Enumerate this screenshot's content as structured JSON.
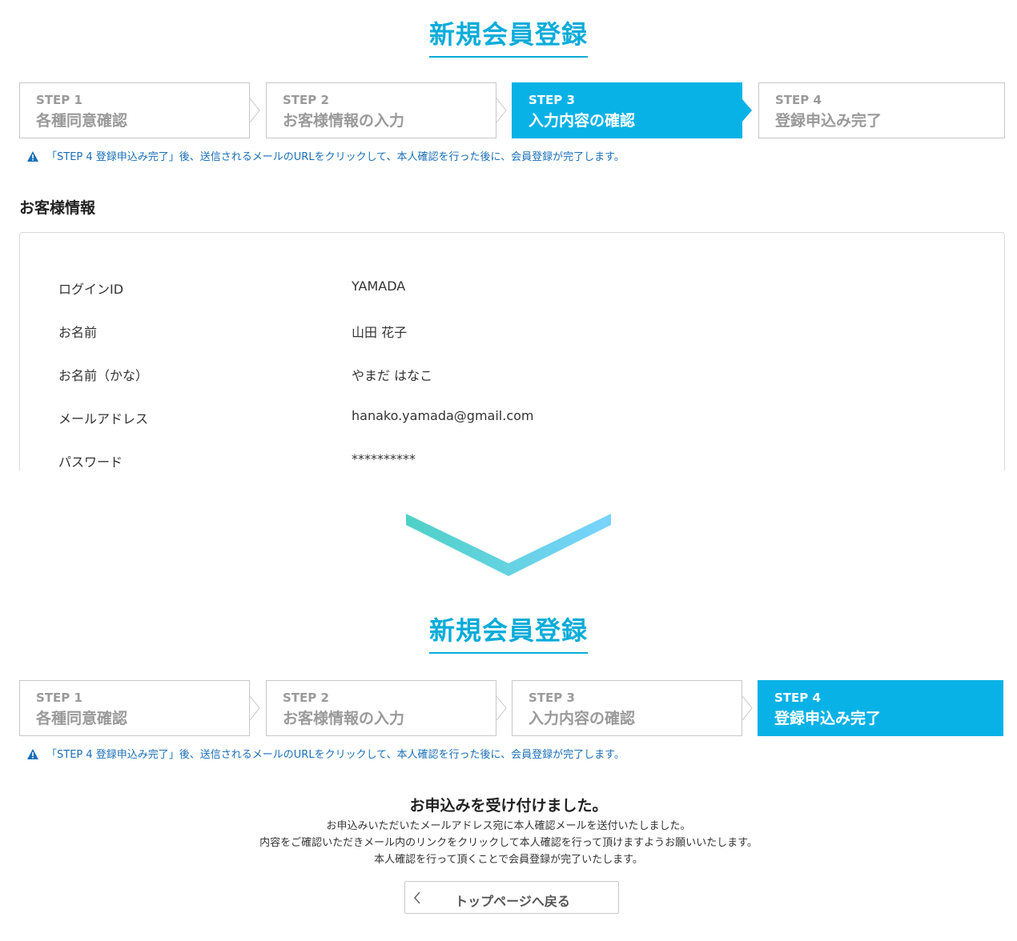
{
  "top": {
    "title": "新規会員登録",
    "steps": [
      {
        "num": "STEP 1",
        "label": "各種同意確認"
      },
      {
        "num": "STEP 2",
        "label": "お客様情報の入力"
      },
      {
        "num": "STEP 3",
        "label": "入力内容の確認"
      },
      {
        "num": "STEP 4",
        "label": "登録申込み完了"
      }
    ],
    "active_step": 3,
    "notice": "「STEP 4 登録申込み完了」後、送信されるメールのURLをクリックして、本人確認を行った後に、会員登録が完了します。",
    "section_title": "お客様情報",
    "fields": [
      {
        "label": "ログインID",
        "value": "YAMADA"
      },
      {
        "label": "お名前",
        "value": "山田 花子"
      },
      {
        "label": "お名前（かな）",
        "value": "やまだ はなこ"
      },
      {
        "label": "メールアドレス",
        "value": "hanako.yamada@gmail.com"
      },
      {
        "label": "パスワード",
        "value": "**********"
      }
    ]
  },
  "bottom": {
    "title": "新規会員登録",
    "steps": [
      {
        "num": "STEP 1",
        "label": "各種同意確認"
      },
      {
        "num": "STEP 2",
        "label": "お客様情報の入力"
      },
      {
        "num": "STEP 3",
        "label": "入力内容の確認"
      },
      {
        "num": "STEP 4",
        "label": "登録申込み完了"
      }
    ],
    "active_step": 4,
    "notice": "「STEP 4 登録申込み完了」後、送信されるメールのURLをクリックして、本人確認を行った後に、会員登録が完了します。",
    "complete_title": "お申込みを受け付けました。",
    "complete_lines": [
      "お申込みいただいたメールアドレス宛に本人確認メールを送付いたしました。",
      "内容をご確認いただきメール内のリンクをクリックして本人確認を行って頂けますようお願いいたします。",
      "本人確認を行って頂くことで会員登録が完了いたします。"
    ],
    "back_button": "トップページへ戻る"
  },
  "colors": {
    "accent": "#09acd9",
    "active_step": "#09b2e6",
    "notice": "#1a6fb8",
    "chevron_start": "#4fd1c5",
    "chevron_end": "#79d3ff"
  },
  "icons": {
    "notice": "warning-triangle-icon",
    "back": "chevron-left-icon",
    "transition": "chevron-down-icon"
  }
}
